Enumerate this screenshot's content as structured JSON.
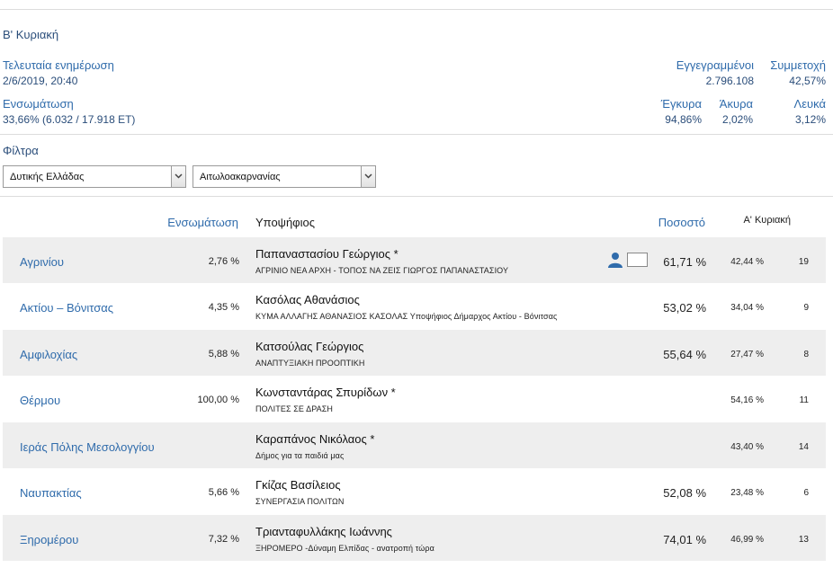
{
  "header": {
    "round_title": "Β' Κυριακή",
    "last_update_label": "Τελευταία ενημέρωση",
    "last_update_value": "2/6/2019, 20:40",
    "registered_label": "Εγγεγραμμένοι",
    "registered_value": "2.796.108",
    "turnout_label": "Συμμετοχή",
    "turnout_value": "42,57%",
    "counted_label": "Ενσωμάτωση",
    "counted_value": "33,66% (6.032 / 17.918 ΕΤ)",
    "valid_label": "Έγκυρα",
    "valid_value": "94,86%",
    "invalid_label": "Άκυρα",
    "invalid_value": "2,02%",
    "blank_label": "Λευκά",
    "blank_value": "3,12%"
  },
  "filters": {
    "title": "Φίλτρα",
    "region": "Δυτικής Ελλάδας",
    "prefecture": "Αιτωλοακαρνανίας"
  },
  "table": {
    "headers": {
      "counted": "Ενσωμάτωση",
      "candidate": "Υποψήφιος",
      "percent": "Ποσοστό",
      "first_round": "Α' Κυριακή"
    },
    "rows": [
      {
        "municipality": "Αγρινίου",
        "counted": "2,76 %",
        "candidate": "Παπαναστασίου Γεώργιος *",
        "party": "ΑΓΡΙΝΙΟ ΝΕΑ ΑΡΧΗ - ΤΟΠΟΣ ΝΑ ΖΕΙΣ ΓΙΩΡΓΟΣ ΠΑΠΑΝΑΣΤΑΣΙΟΥ",
        "percent": "61,71 %",
        "first_round": "42,44 %",
        "votes": "19"
      },
      {
        "municipality": "Ακτίου – Βόνιτσας",
        "counted": "4,35 %",
        "candidate": "Κασόλας Αθανάσιος",
        "party": "ΚΥΜΑ ΑΛΛΑΓΗΣ ΑΘΑΝΑΣΙΟΣ ΚΑΣΟΛΑΣ Υποψήφιος Δήμαρχος Ακτίου - Βόνιτσας",
        "percent": "53,02 %",
        "first_round": "34,04 %",
        "votes": "9"
      },
      {
        "municipality": "Αμφιλοχίας",
        "counted": "5,88 %",
        "candidate": "Κατσούλας Γεώργιος",
        "party": "ΑΝΑΠΤΥΞΙΑΚΗ ΠΡΟΟΠΤΙΚΗ",
        "percent": "55,64 %",
        "first_round": "27,47 %",
        "votes": "8"
      },
      {
        "municipality": "Θέρμου",
        "counted": "100,00 %",
        "candidate": "Κωνσταντάρας Σπυρίδων *",
        "party": "ΠΟΛΙΤΕΣ ΣΕ ΔΡΑΣΗ",
        "percent": "",
        "first_round": "54,16 %",
        "votes": "11"
      },
      {
        "municipality": "Ιεράς Πόλης Μεσολογγίου",
        "counted": "",
        "candidate": "Καραπάνος Νικόλαος *",
        "party": "Δήμος για τα παιδιά μας",
        "percent": "",
        "first_round": "43,40 %",
        "votes": "14"
      },
      {
        "municipality": "Ναυπακτίας",
        "counted": "5,66 %",
        "candidate": "Γκίζας Βασίλειος",
        "party": "ΣΥΝΕΡΓΑΣΙΑ ΠΟΛΙΤΩΝ",
        "percent": "52,08 %",
        "first_round": "23,48 %",
        "votes": "6"
      },
      {
        "municipality": "Ξηρομέρου",
        "counted": "7,32 %",
        "candidate": "Τριανταφυλλάκης Ιωάννης",
        "party": "ΞΗΡΟΜΕΡΟ -Δύναμη Ελπίδας - ανατροπή τώρα",
        "percent": "74,01 %",
        "first_round": "46,99 %",
        "votes": "13"
      }
    ]
  },
  "icons": {
    "person": "person-icon",
    "box": "checkbox-icon"
  },
  "colors": {
    "accent": "#2f6bab",
    "heading": "#2a4d7a",
    "row_shade": "#eeeeee"
  }
}
